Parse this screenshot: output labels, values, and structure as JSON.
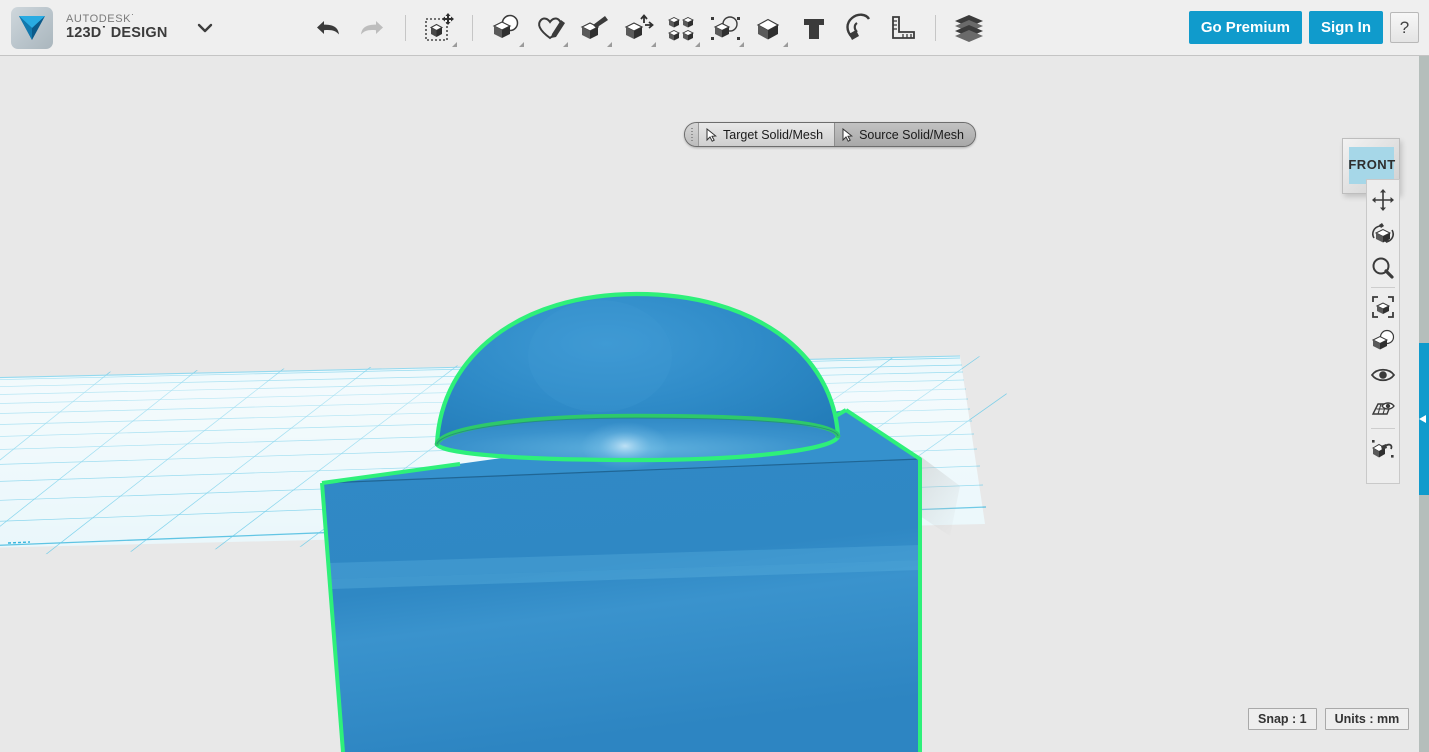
{
  "app": {
    "brand_line1": "AUTODESK˙",
    "brand_line2": "123D˙ DESIGN",
    "logo_icon": "autodesk-123d-logo"
  },
  "topbar": {
    "menu_caret_icon": "chevron-down-icon",
    "history_tools": [
      {
        "name": "undo-button",
        "icon": "undo-arrow-icon",
        "label": "Undo",
        "enabled": true,
        "dropdown": false
      },
      {
        "name": "redo-button",
        "icon": "redo-arrow-icon",
        "label": "Redo",
        "enabled": false,
        "dropdown": false
      }
    ],
    "main_tools": [
      {
        "name": "transform-tool",
        "icon": "cube-move-icon",
        "label": "Transform",
        "active": true,
        "dropdown": true
      },
      {
        "name": "primitives-tool",
        "icon": "cube-sphere-icon",
        "label": "Primitives",
        "active": false,
        "dropdown": true
      },
      {
        "name": "sketch-tool",
        "icon": "heart-pencil-icon",
        "label": "Sketch",
        "active": false,
        "dropdown": true
      },
      {
        "name": "construct-tool",
        "icon": "cube-extrude-icon",
        "label": "Construct",
        "active": false,
        "dropdown": true
      },
      {
        "name": "modify-tool",
        "icon": "cube-arrows-icon",
        "label": "Modify",
        "active": false,
        "dropdown": true
      },
      {
        "name": "pattern-tool",
        "icon": "four-cubes-icon",
        "label": "Pattern",
        "active": false,
        "dropdown": true
      },
      {
        "name": "grouping-tool",
        "icon": "cube-circle-select-icon",
        "label": "Grouping",
        "active": false,
        "dropdown": true
      },
      {
        "name": "combine-tool",
        "icon": "cube-combine-icon",
        "label": "Combine",
        "active": false,
        "dropdown": true
      },
      {
        "name": "text-tool",
        "icon": "text-T-icon",
        "label": "Text",
        "active": false,
        "dropdown": false
      },
      {
        "name": "snap-tool",
        "icon": "magnet-icon",
        "label": "Snap",
        "active": false,
        "dropdown": false
      },
      {
        "name": "measure-tool",
        "icon": "ruler-square-icon",
        "label": "Measure",
        "active": false,
        "dropdown": false
      }
    ],
    "material_tools": [
      {
        "name": "material-tool",
        "icon": "layered-stack-icon",
        "label": "Material",
        "active": false,
        "dropdown": false
      }
    ],
    "go_premium_label": "Go Premium",
    "sign_in_label": "Sign In",
    "help_label": "?",
    "accent_color": "#109bcc"
  },
  "selection_prompt": {
    "grip_icon": "drag-grip-icon",
    "segments": [
      {
        "name": "target-solid-mesh-step",
        "label": "Target Solid/Mesh",
        "icon": "cursor-arrow-icon",
        "state": "active"
      },
      {
        "name": "source-solid-mesh-step",
        "label": "Source Solid/Mesh",
        "icon": "cursor-arrow-icon",
        "state": "inactive"
      }
    ]
  },
  "viewcube": {
    "face_label": "FRONT",
    "icon": "view-cube-icon"
  },
  "nav_toolbar": {
    "items": [
      {
        "name": "pan-tool",
        "icon": "pan-arrows-icon",
        "label": "Pan"
      },
      {
        "name": "orbit-tool",
        "icon": "orbit-cube-icon",
        "label": "Orbit"
      },
      {
        "name": "zoom-tool",
        "icon": "magnifier-icon",
        "label": "Zoom"
      },
      {
        "name": "fit-tool",
        "icon": "fit-to-window-cube-icon",
        "label": "Fit"
      },
      {
        "name": "display-style-tool",
        "icon": "cube-shaded-icon",
        "label": "Display Settings"
      },
      {
        "name": "visibility-tool",
        "icon": "eye-icon",
        "label": "Visibility"
      },
      {
        "name": "grid-visibility-tool",
        "icon": "grid-eye-icon",
        "label": "Grid / Snap Settings"
      },
      {
        "name": "snap-settings-tool",
        "icon": "cube-snap-icon",
        "label": "Snap Settings"
      }
    ]
  },
  "status": {
    "snap_label": "Snap : 1",
    "units_label": "Units : mm"
  },
  "scene": {
    "background_color": "#e8e8e8",
    "grid_plane_color": "#5ec8e8",
    "solid_color": "#2f88c4",
    "selection_color": "#2ef07a",
    "objects": [
      {
        "name": "box-solid",
        "shape": "box",
        "selected": true
      },
      {
        "name": "dome-solid",
        "shape": "hemisphere",
        "selected": true
      }
    ]
  },
  "scrollbar": {
    "name": "vertical-scrollbar",
    "track_color": "#b5bebb",
    "thumb_color": "#109bcc"
  }
}
